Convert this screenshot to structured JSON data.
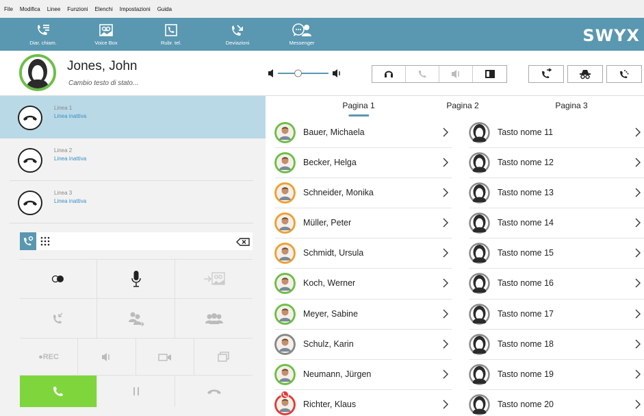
{
  "menu": [
    "File",
    "Modifica",
    "Linee",
    "Funzioni",
    "Elenchi",
    "Impostazioni",
    "Guida"
  ],
  "toolbar": {
    "items": [
      {
        "label": "Diar. chiam.",
        "icon": "call-journal-icon"
      },
      {
        "label": "Voice Box",
        "icon": "voicebox-icon"
      },
      {
        "label": "Rubr. tel.",
        "icon": "phonebook-icon"
      },
      {
        "label": "Deviazioni",
        "icon": "forwarding-icon"
      },
      {
        "label": "Messenger",
        "icon": "messenger-icon"
      }
    ],
    "logo": "SWYX"
  },
  "user": {
    "name": "Jones, John",
    "status_placeholder": "Cambio testo di stato...",
    "presence_color": "#6cbf45"
  },
  "volume": {
    "level": 0.4
  },
  "lines": [
    {
      "name": "Linea 1",
      "state": "Linea inattiva",
      "active": true
    },
    {
      "name": "Linea 2",
      "state": "Linea inattiva",
      "active": false
    },
    {
      "name": "Linea 3",
      "state": "Linea inattiva",
      "active": false
    }
  ],
  "dial": {
    "value": ""
  },
  "actions": {
    "rec_label": "●REC"
  },
  "tabs": [
    {
      "label": "Pagina 1",
      "selected": true
    },
    {
      "label": "Pagina 2",
      "selected": false
    },
    {
      "label": "Pagina 3",
      "selected": false
    }
  ],
  "speed_dial_left": [
    {
      "name": "Bauer, Michaela",
      "ring": "#6cbf45"
    },
    {
      "name": "Becker, Helga",
      "ring": "#6cbf45"
    },
    {
      "name": "Schneider, Monika",
      "ring": "#f0a030"
    },
    {
      "name": "Müller, Peter",
      "ring": "#f0a030"
    },
    {
      "name": "Schmidt, Ursula",
      "ring": "#f0a030"
    },
    {
      "name": "Koch, Werner",
      "ring": "#6cbf45"
    },
    {
      "name": "Meyer, Sabine",
      "ring": "#6cbf45"
    },
    {
      "name": "Schulz, Karin",
      "ring": "#888888"
    },
    {
      "name": "Neumann, Jürgen",
      "ring": "#6cbf45"
    },
    {
      "name": "Richter, Klaus",
      "ring": "#e53935"
    }
  ],
  "speed_dial_right": [
    {
      "name": "Tasto nome 11"
    },
    {
      "name": "Tasto nome 12"
    },
    {
      "name": "Tasto nome 13"
    },
    {
      "name": "Tasto nome 14"
    },
    {
      "name": "Tasto nome 15"
    },
    {
      "name": "Tasto nome 16"
    },
    {
      "name": "Tasto nome 17"
    },
    {
      "name": "Tasto nome 18"
    },
    {
      "name": "Tasto nome 19"
    },
    {
      "name": "Tasto nome 20"
    }
  ]
}
